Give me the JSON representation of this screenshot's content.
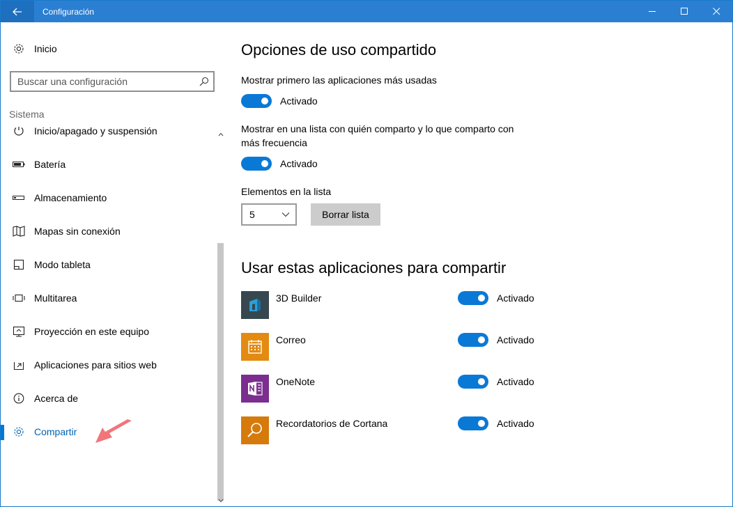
{
  "window": {
    "title": "Configuración"
  },
  "sidebar": {
    "home_label": "Inicio",
    "search_placeholder": "Buscar una configuración",
    "section_title": "Sistema",
    "items": [
      {
        "label": "Inicio/apagado y suspensión",
        "icon": "power-icon"
      },
      {
        "label": "Batería",
        "icon": "battery-icon"
      },
      {
        "label": "Almacenamiento",
        "icon": "storage-icon"
      },
      {
        "label": "Mapas sin conexión",
        "icon": "map-icon"
      },
      {
        "label": "Modo tableta",
        "icon": "tablet-icon"
      },
      {
        "label": "Multitarea",
        "icon": "multitask-icon"
      },
      {
        "label": "Proyección en este equipo",
        "icon": "projection-icon"
      },
      {
        "label": "Aplicaciones para sitios web",
        "icon": "web-apps-icon"
      },
      {
        "label": "Acerca de",
        "icon": "info-icon"
      },
      {
        "label": "Compartir",
        "icon": "gear-icon",
        "selected": true
      }
    ]
  },
  "main": {
    "section1_title": "Opciones de uso compartido",
    "option1_label": "Mostrar primero las aplicaciones más usadas",
    "option1_state": "Activado",
    "option2_label_line1": "Mostrar en una lista con quién comparto y lo que comparto con",
    "option2_label_line2": "más frecuencia",
    "option2_state": "Activado",
    "list_items_label": "Elementos en la lista",
    "list_items_value": "5",
    "clear_button": "Borrar lista",
    "section2_title": "Usar estas aplicaciones para compartir",
    "apps": [
      {
        "name": "3D Builder",
        "state": "Activado",
        "tile_color": "#37474f",
        "icon": "3d-builder-icon"
      },
      {
        "name": "Correo",
        "state": "Activado",
        "tile_color": "#e38a11",
        "icon": "mail-calendar-icon"
      },
      {
        "name": "OneNote",
        "state": "Activado",
        "tile_color": "#7b2e8f",
        "icon": "onenote-icon"
      },
      {
        "name": "Recordatorios de Cortana",
        "state": "Activado",
        "tile_color": "#d67a0c",
        "icon": "cortana-search-icon"
      }
    ]
  },
  "colors": {
    "titlebar": "#2b7fd2",
    "accent": "#0078d7",
    "toggle_on": "#0a79d6",
    "arrow": "#f0767c"
  }
}
